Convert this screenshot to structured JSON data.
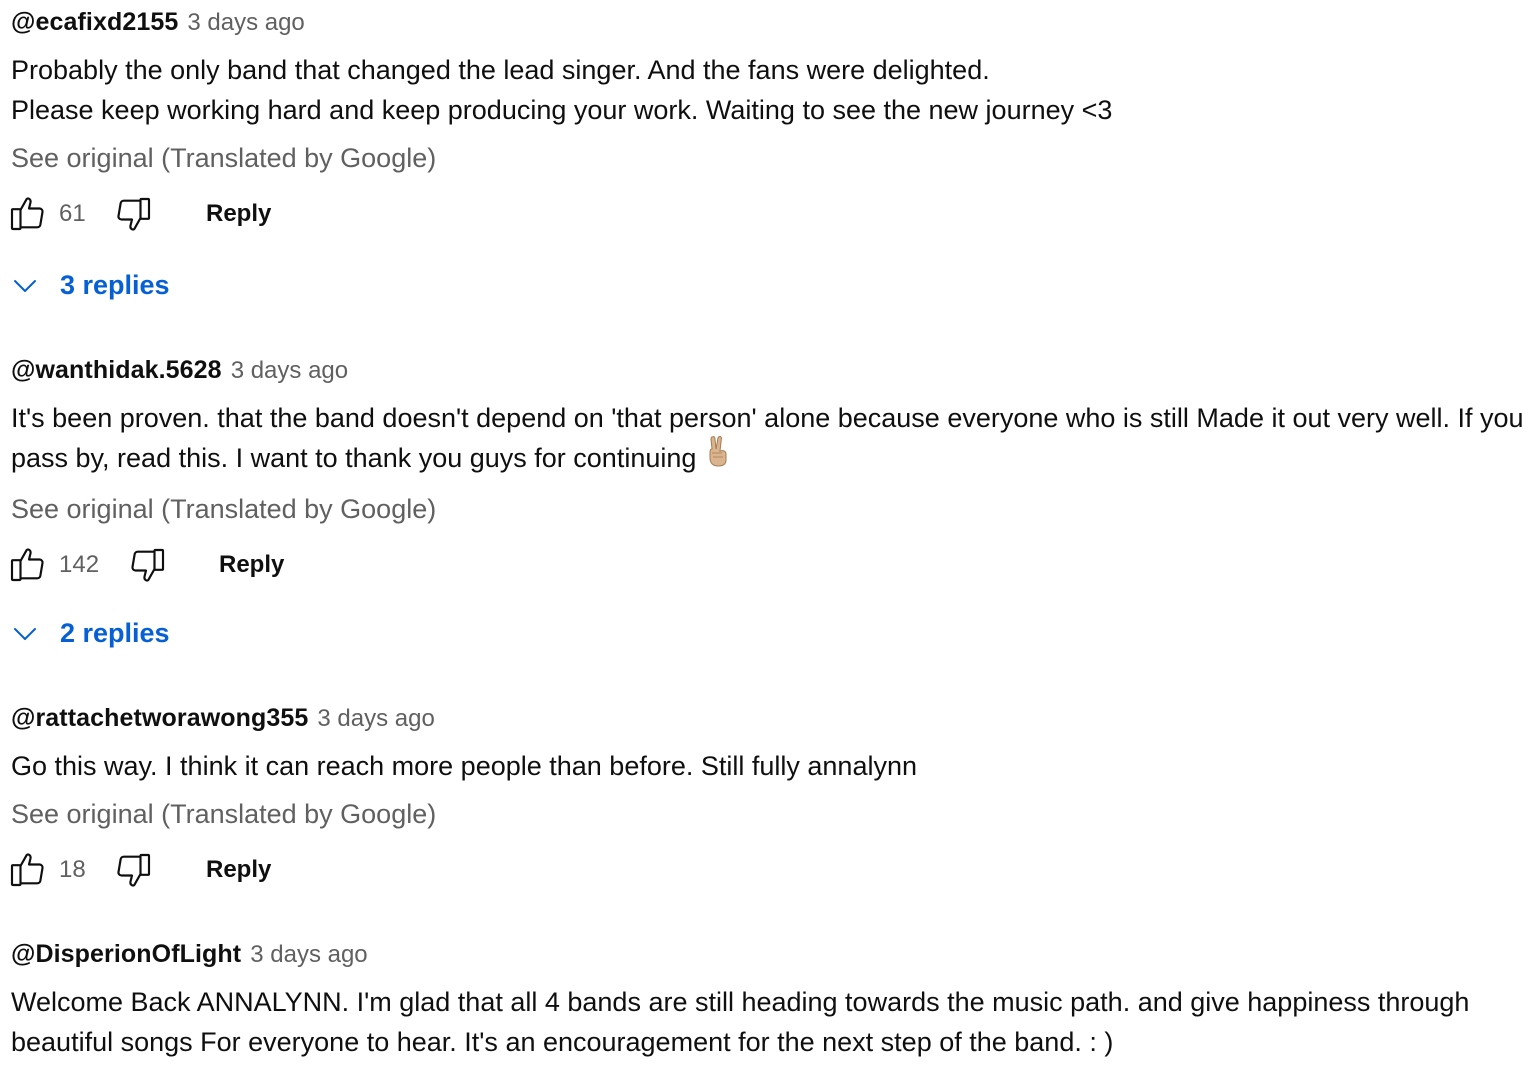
{
  "comments": [
    {
      "author": "@ecafixd2155",
      "time": "3 days ago",
      "text": "Probably the only band that changed the lead singer. And the fans were delighted.\nPlease keep working hard and keep producing your work. Waiting to see the new journey <3",
      "translate_label": "See original (Translated by Google)",
      "likes": "61",
      "reply_label": "Reply",
      "replies_label": "3 replies"
    },
    {
      "author": "@wanthidak.5628",
      "time": "3 days ago",
      "text": "It's been proven. that the band doesn't depend on 'that person' alone because everyone who is still Made it out very well. If you pass by, read this. I want to thank you guys for continuing",
      "emoji": "victory-hand-emoji",
      "translate_label": "See original (Translated by Google)",
      "likes": "142",
      "reply_label": "Reply",
      "replies_label": "2 replies"
    },
    {
      "author": "@rattachetworawong355",
      "time": "3 days ago",
      "text": "Go this way. I think it can reach more people than before. Still fully annalynn",
      "translate_label": "See original (Translated by Google)",
      "likes": "18",
      "reply_label": "Reply"
    },
    {
      "author": "@DisperionOfLight",
      "time": "3 days ago",
      "text": "Welcome Back ANNALYNN. I'm glad that all 4 bands are still heading towards the music path. and give happiness through beautiful songs For everyone to hear. It's an encouragement for the next step of the band. : )"
    }
  ],
  "icons": {
    "like": "thumb-up-icon",
    "dislike": "thumb-down-icon",
    "expand": "chevron-down-icon"
  },
  "colors": {
    "link_blue": "#065fd4",
    "secondary_text": "#606060",
    "primary_text": "#0f0f0f"
  }
}
